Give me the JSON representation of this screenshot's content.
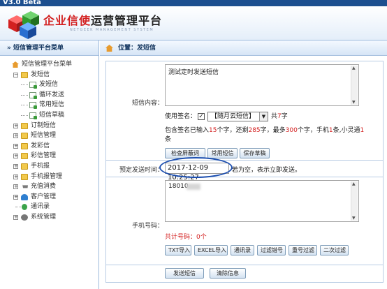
{
  "app": {
    "version_label": "V3.0 Beta",
    "brand_prefix": "企业信使",
    "brand_suffix": "运营管理平台",
    "brand_sub": "NETGEEK MANAGEMENT SYSTEM"
  },
  "sidebar": {
    "header": "» 短信管理平台菜单",
    "root": "短信管理平台菜单",
    "send_sms_group": "发短信",
    "send_sms_children": [
      "发短信",
      "循环发送",
      "常用短信",
      "短信草稿"
    ],
    "groups": [
      "订制短信",
      "短信管理",
      "发彩信",
      "彩信管理",
      "手机报",
      "手机报管理",
      "充值消费",
      "客户管理",
      "通讯录",
      "系统管理"
    ]
  },
  "breadcrumb": {
    "text": "位置：发短信"
  },
  "form": {
    "content_label": "短信内容：",
    "content_value": "测试定时发送短信",
    "signature_prefix": "使用签名：",
    "signature_checked": "✓",
    "signature_value": "【随月云短信】",
    "signature_count_prefix": "共",
    "signature_count": "7",
    "signature_count_suffix": "字",
    "info": {
      "p1": "包含签名已输入",
      "n1": "15",
      "p2": "个字，还剩",
      "n2": "285",
      "p3": "字，最多",
      "n3": "300",
      "p4": "个字，手机",
      "n4": "1",
      "p5": "条,小灵通",
      "n5": "1",
      "p6": "条"
    },
    "buttons": {
      "check_words": "检查屏蔽词",
      "common_sms": "常用短信",
      "save_draft": "保存草稿"
    },
    "schedule_label": "预定发送时间：",
    "schedule_value": "2017-12-09 10:25:27",
    "schedule_hint": "若为空，表示立即发送。",
    "phone_label": "手机号码：",
    "phone_value": "18010",
    "total_prefix": "共计号码：",
    "total_value": "0",
    "total_suffix": "个",
    "import_buttons": [
      "TXT导入",
      "EXCEL导入",
      "通讯录",
      "过滤错号",
      "重号过滤",
      "二次过滤"
    ],
    "send_button": "发送短信",
    "clear_button": "清除信息"
  },
  "colors": {
    "accent_blue": "#1d4fb0",
    "highlight_red": "#d32020",
    "header_blue": "#14365f"
  }
}
